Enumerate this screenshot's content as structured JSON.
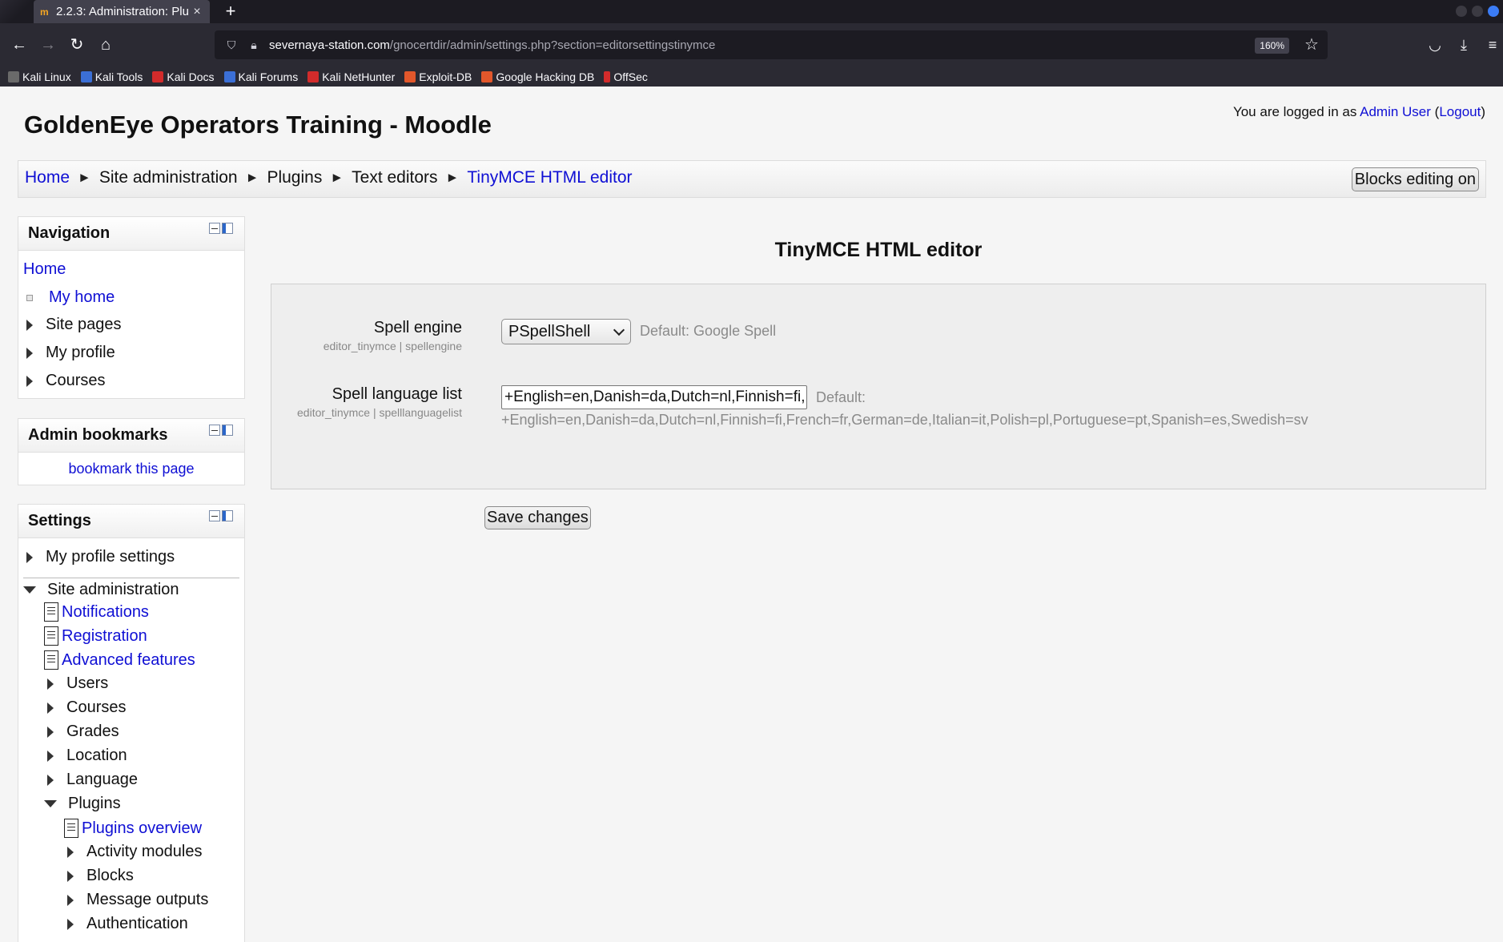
{
  "browser": {
    "tab_title": "2.2.3: Administration: Plu",
    "favicon": "moodle-icon",
    "url_host": "severnaya-station.com",
    "url_path": "/gnocertdir/admin/settings.php?section=editorsettingstinymce",
    "zoom": "160%",
    "bookmarks": [
      {
        "label": "Kali Linux",
        "color": "#6a6a6a"
      },
      {
        "label": "Kali Tools",
        "color": "#3b6fd6"
      },
      {
        "label": "Kali Docs",
        "color": "#d22b2b"
      },
      {
        "label": "Kali Forums",
        "color": "#3b6fd6"
      },
      {
        "label": "Kali NetHunter",
        "color": "#d22b2b"
      },
      {
        "label": "Exploit-DB",
        "color": "#e2572b"
      },
      {
        "label": "Google Hacking DB",
        "color": "#e2572b"
      },
      {
        "label": "OffSec",
        "color": "#d22b2b"
      }
    ]
  },
  "page": {
    "site_title": "GoldenEye Operators Training - Moodle",
    "login_prefix": "You are logged in as ",
    "login_user": "Admin User",
    "login_open": " (",
    "logout_label": "Logout",
    "login_close": ")",
    "breadcrumb": [
      "Home",
      "Site administration",
      "Plugins",
      "Text editors",
      "TinyMCE HTML editor"
    ],
    "breadcrumb_sep": "►",
    "blocks_editing_label": "Blocks editing on"
  },
  "navigation_block": {
    "title": "Navigation",
    "home": "Home",
    "items": [
      "My home",
      "Site pages",
      "My profile",
      "Courses"
    ]
  },
  "admin_bookmarks_block": {
    "title": "Admin bookmarks",
    "link": "bookmark this page"
  },
  "settings_block": {
    "title": "Settings",
    "my_profile_settings": "My profile settings",
    "site_administration": "Site administration",
    "admin_items": [
      "Notifications",
      "Registration",
      "Advanced features",
      "Users",
      "Courses",
      "Grades",
      "Location",
      "Language",
      "Plugins"
    ],
    "plugin_items": [
      "Plugins overview",
      "Activity modules",
      "Blocks",
      "Message outputs",
      "Authentication"
    ]
  },
  "main": {
    "heading": "TinyMCE HTML editor",
    "spell_engine": {
      "label": "Spell engine",
      "sub": "editor_tinymce | spellengine",
      "value": "PSpellShell",
      "default": "Default: Google Spell"
    },
    "spell_language": {
      "label": "Spell language list",
      "sub": "editor_tinymce | spelllanguagelist",
      "value": "+English=en,Danish=da,Dutch=nl,Finnish=fi,French=fr,German=de,Italian=it,Polish=pl,Portuguese=pt,Spanish=es,Swedish=sv",
      "default_label": "Default:",
      "default_value": "+English=en,Danish=da,Dutch=nl,Finnish=fi,French=fr,German=de,Italian=it,Polish=pl,Portuguese=pt,Spanish=es,Swedish=sv"
    },
    "save_label": "Save changes"
  },
  "colors": {
    "link": "#0f0fd4",
    "chrome_dark": "#1c1b22",
    "chrome": "#2b2a33"
  }
}
